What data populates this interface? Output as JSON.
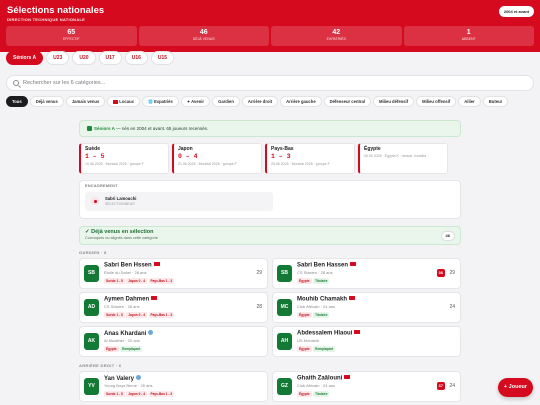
{
  "header": {
    "title": "Sélections nationales",
    "subtitle": "DIRECTION TECHNIQUE NATIONALE",
    "pill": "2004 et avant"
  },
  "stats": [
    {
      "value": "65",
      "label": "EFFECTIF"
    },
    {
      "value": "46",
      "label": "DÉJÀ VENUS"
    },
    {
      "value": "42",
      "label": "EXPATRIÉS"
    },
    {
      "value": "1",
      "label": "ABSENT"
    }
  ],
  "categories": [
    "Séniors A",
    "U23",
    "U20",
    "U17",
    "U16",
    "U15"
  ],
  "search": {
    "placeholder": "Rechercher sur les 6 catégories..."
  },
  "filters": [
    "Tous",
    "Déjà venus",
    "Jamais venus",
    "Locaux",
    "Expatriés",
    "Avenir",
    "Gardien",
    "Arrière droit",
    "Arrière gauche",
    "Défenseur central",
    "Milieu défensif",
    "Milieu offensif",
    "Ailier",
    "Buteur"
  ],
  "notice": {
    "bold": "Séniors A",
    "text": " — nés en 2004 et avant. 65 joueurs recensés."
  },
  "matches": [
    {
      "team": "Suède",
      "score": "1 – 5",
      "date": "15.06.2026 · Mondial 2026 · groupe F"
    },
    {
      "team": "Japon",
      "score": "0 – 4",
      "date": "21.06.2026 · Mondial 2026 · groupe F"
    },
    {
      "team": "Pays-Bas",
      "score": "1 – 3",
      "date": "25.06.2026 · Mondial 2026 · groupe F"
    },
    {
      "team": "Égypte",
      "score": "",
      "date": "06.09.2025 · Égypte K · amical, Ismaïlia"
    }
  ],
  "staff": {
    "heading": "ENCADREMENT",
    "name": "Sabri Lamouchi",
    "role": "SÉLECTIONNEUR"
  },
  "group": {
    "title": "✓ Déjà venus en sélection",
    "sub": "Convoqués ou alignés dans cette catégorie",
    "count": "46"
  },
  "sections": {
    "gardien": "GARDIEN · 8",
    "arriere": "ARRIÈRE DROIT · 6"
  },
  "players": [
    {
      "initials": "SB",
      "name": "Sabri Ben Hssen",
      "club": "Étoile du Sahel · 28 ans",
      "tags": [
        [
          "Suède 1 - 5",
          "r"
        ],
        [
          "Japon 0 - 4",
          "r"
        ],
        [
          "Pays-Bas 1 - 3",
          "r"
        ]
      ],
      "num": "29",
      "badge": ""
    },
    {
      "initials": "SB",
      "name": "Sabri Ben Hassen",
      "club": "CS Sfaxien · 28 ans",
      "tags": [
        [
          "Égypte",
          "r"
        ],
        [
          "Titulaire",
          "g"
        ]
      ],
      "num": "29",
      "badge": "36"
    },
    {
      "initials": "AD",
      "name": "Aymen Dahmen",
      "club": "CS Sfaxien · 28 ans",
      "tags": [
        [
          "Suède 1 - 5",
          "r"
        ],
        [
          "Japon 0 - 4",
          "r"
        ],
        [
          "Pays-Bas 1 - 3",
          "r"
        ]
      ],
      "num": "28",
      "badge": ""
    },
    {
      "initials": "MC",
      "name": "Mouhib Chamakh",
      "club": "Club Africain · 24 ans",
      "tags": [
        [
          "Égypte",
          "r"
        ],
        [
          "Titulaire",
          "g"
        ]
      ],
      "num": "24",
      "badge": ""
    },
    {
      "initials": "AK",
      "name": "Anas Khardani",
      "club": "Al Muaither · 20 ans",
      "tags": [
        [
          "Égypte",
          "r"
        ],
        [
          "Remplaçant",
          "g"
        ]
      ],
      "num": "",
      "badge": ""
    },
    {
      "initials": "AH",
      "name": "Abdessalem Hlaoui",
      "club": "US Monastir",
      "tags": [
        [
          "Égypte",
          "r"
        ],
        [
          "Remplaçant",
          "g"
        ]
      ],
      "num": "",
      "badge": ""
    },
    {
      "initials": "YV",
      "name": "Yan Valery",
      "club": "Young Boys Berne · 26 ans",
      "tags": [
        [
          "Suède 1 - 5",
          "r"
        ],
        [
          "Japon 0 - 4",
          "r"
        ],
        [
          "Pays-Bas 1 - 3",
          "r"
        ]
      ],
      "num": "",
      "badge": ""
    },
    {
      "initials": "GZ",
      "name": "Ghaith Zaâlouni",
      "club": "Club Africain · 24 ans",
      "tags": [
        [
          "Égypte",
          "r"
        ],
        [
          "Titulaire",
          "g"
        ]
      ],
      "num": "24",
      "badge": "37"
    }
  ],
  "fab": "+ Joueur",
  "colors": {
    "brand": "#d50a1e",
    "success": "#137a35"
  }
}
